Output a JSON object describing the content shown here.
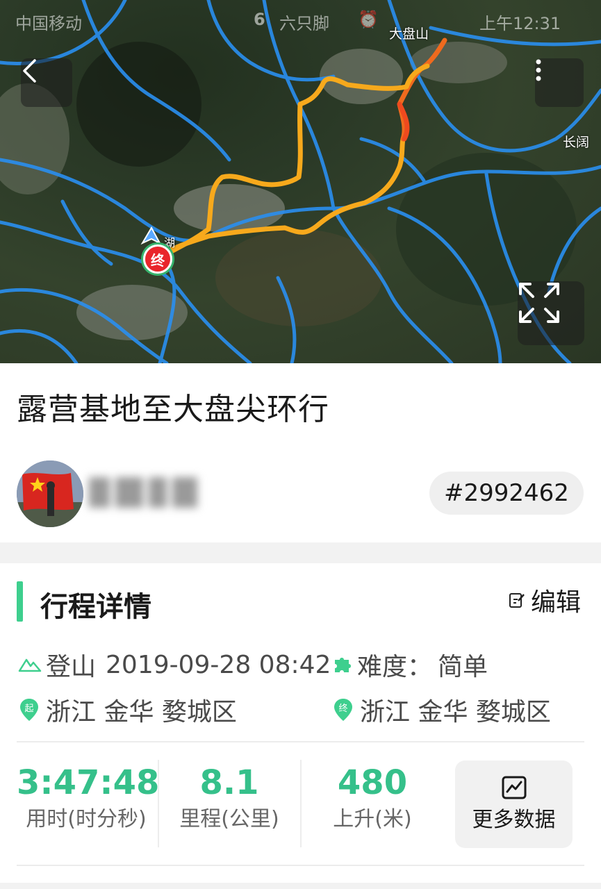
{
  "status_bar": {
    "carrier": "中国移动",
    "notification_count": "6",
    "notification_text": "六只脚",
    "time": "上午12:31"
  },
  "map": {
    "labels": {
      "peak": "大盘山",
      "east": "长阔",
      "start_town": "湖"
    },
    "end_marker": "终",
    "colors": {
      "track_orange": "#f7a91c",
      "track_red": "#ef5a1e",
      "river_blue": "#2a8ff0"
    }
  },
  "trip": {
    "title": "露营基地至大盘尖环行",
    "id_badge": "#2992462"
  },
  "details": {
    "section_title": "行程详情",
    "edit_label": "编辑",
    "activity_type": "登山",
    "datetime": "2019-09-28 08:42",
    "difficulty_label": "难度：",
    "difficulty_value": "简单",
    "start_marker": "起",
    "end_marker": "终",
    "start_location": "浙江 金华 婺城区",
    "end_location": "浙江 金华 婺城区",
    "stats": [
      {
        "value": "3:47:48",
        "label": "用时(时分秒)"
      },
      {
        "value": "8.1",
        "label": "里程(公里)"
      },
      {
        "value": "480",
        "label": "上升(米)"
      }
    ],
    "more_data_label": "更多数据",
    "accent_color": "#3ecf8e"
  }
}
